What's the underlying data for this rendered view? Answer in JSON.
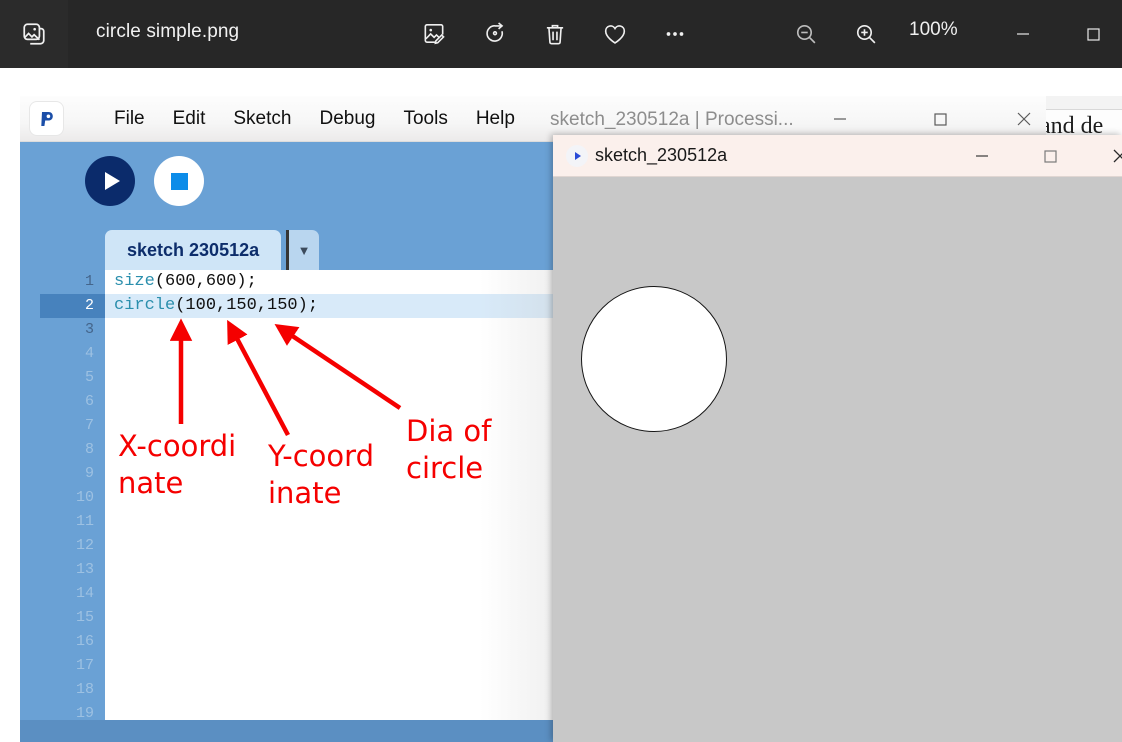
{
  "photos_app": {
    "app_icon": "photo-stack-icon",
    "file_title": "circle simple.png",
    "toolbar_icons": [
      {
        "name": "edit-image-icon",
        "glyph": "edit-image"
      },
      {
        "name": "rotate-icon",
        "glyph": "rotate"
      },
      {
        "name": "delete-icon",
        "glyph": "trash"
      },
      {
        "name": "favorite-icon",
        "glyph": "heart"
      },
      {
        "name": "more-options-icon",
        "glyph": "ellipsis"
      },
      {
        "name": "zoom-out-icon",
        "glyph": "zoom-out"
      },
      {
        "name": "zoom-in-icon",
        "glyph": "zoom-in"
      }
    ],
    "zoom_level": "100%",
    "window_controls": {
      "minimize": "—",
      "maximize": "□"
    },
    "background_color": "#272727"
  },
  "background_document": {
    "visible_text": "and de"
  },
  "processing_ide": {
    "logo": "processing-logo-icon",
    "menus": [
      "File",
      "Edit",
      "Sketch",
      "Debug",
      "Tools",
      "Help"
    ],
    "window_title": "sketch_230512a | Processi...",
    "window_controls": {
      "minimize": "—",
      "maximize": "□",
      "close": "✕"
    },
    "toolbar": {
      "run_button": "run-button",
      "stop_button": "stop-button",
      "background_color": "#6aa1d5"
    },
    "tab": {
      "label": "sketch 230512a",
      "dropdown_glyph": "▼"
    },
    "editor": {
      "active_line": 2,
      "lines": [
        {
          "num": "1",
          "keyword": "size",
          "rest": "(600,600);"
        },
        {
          "num": "2",
          "keyword": "circle",
          "rest": "(100,150,150);"
        },
        {
          "num": "3",
          "keyword": "",
          "rest": ""
        },
        {
          "num": "4",
          "keyword": "",
          "rest": ""
        },
        {
          "num": "5",
          "keyword": "",
          "rest": ""
        },
        {
          "num": "6",
          "keyword": "",
          "rest": ""
        },
        {
          "num": "7",
          "keyword": "",
          "rest": ""
        },
        {
          "num": "8",
          "keyword": "",
          "rest": ""
        },
        {
          "num": "9",
          "keyword": "",
          "rest": ""
        },
        {
          "num": "10",
          "keyword": "",
          "rest": ""
        },
        {
          "num": "11",
          "keyword": "",
          "rest": ""
        },
        {
          "num": "12",
          "keyword": "",
          "rest": ""
        },
        {
          "num": "13",
          "keyword": "",
          "rest": ""
        },
        {
          "num": "14",
          "keyword": "",
          "rest": ""
        },
        {
          "num": "15",
          "keyword": "",
          "rest": ""
        },
        {
          "num": "16",
          "keyword": "",
          "rest": ""
        },
        {
          "num": "17",
          "keyword": "",
          "rest": ""
        },
        {
          "num": "18",
          "keyword": "",
          "rest": ""
        },
        {
          "num": "19",
          "keyword": "",
          "rest": ""
        }
      ]
    }
  },
  "annotations": {
    "color": "#f50000",
    "labels": [
      {
        "name": "x-coordinate-annotation",
        "text": "X-coordi\nnate"
      },
      {
        "name": "y-coordinate-annotation",
        "text": "Y-coord\ninate"
      },
      {
        "name": "diameter-annotation",
        "text": "Dia of\ncircle"
      }
    ]
  },
  "sketch_window": {
    "icon": "processing-run-icon",
    "title": "sketch_230512a",
    "window_controls": {
      "minimize": "—",
      "maximize": "□",
      "close": "✕"
    },
    "canvas": {
      "background_color": "#c8c8c8",
      "shape": "circle",
      "fill_color": "#ffffff",
      "stroke_color": "#161616"
    }
  }
}
